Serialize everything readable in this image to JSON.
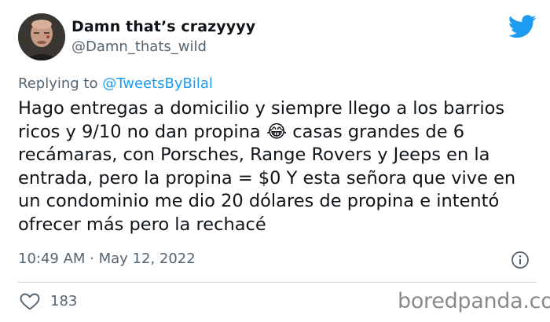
{
  "author": {
    "display_name": "Damn that’s crazyyyy",
    "handle": "@Damn_thats_wild",
    "avatar_icon": "user-photo-avatar"
  },
  "brand_icon": "twitter-bird-icon",
  "reply": {
    "prefix": "Replying to ",
    "mention": "@TweetsByBilal"
  },
  "tweet": {
    "text": "Hago entregas a domicilio y siempre llego a los barrios\nricos y 9/10 no dan propina 😂 casas grandes de 6\nrecámaras, con Porsches, Range Rovers y Jeeps en la\nentrada, pero la propina = $0 Y esta señora que vive en\nun condominio me dio 20 dólares de propina e intentó\nofrecer más pero la rechacé"
  },
  "timestamp": "10:49 AM · May 12, 2022",
  "info_icon": "info-icon",
  "engagement": {
    "likes_icon": "heart-icon",
    "likes_count": "183"
  },
  "watermark": "boredpanda.com",
  "colors": {
    "brand": "#1d9bf0",
    "text": "#0f1419",
    "secondary": "#536471",
    "divider": "#cfd9de"
  }
}
